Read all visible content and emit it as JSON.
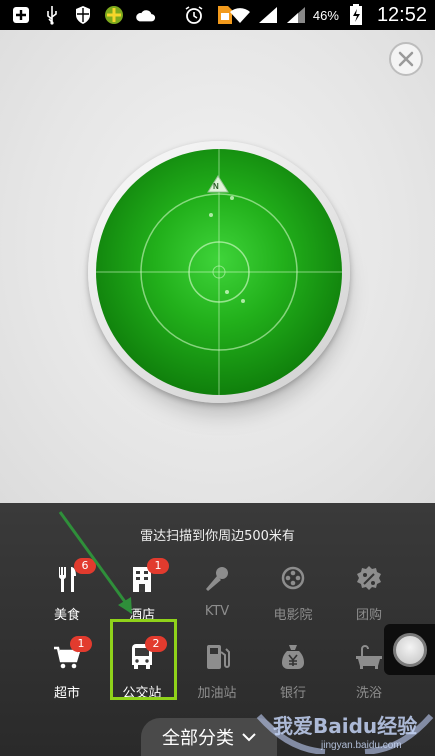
{
  "status_bar": {
    "battery_percent": "46%",
    "time": "12:52",
    "left_icons": [
      "plus-icon",
      "usb-icon",
      "shield-icon",
      "app-icon",
      "cloud-icon",
      "alarm-icon",
      "sim-icon"
    ],
    "right_icons": [
      "wifi-icon",
      "signal-icon",
      "signal-icon",
      "battery-icon"
    ]
  },
  "radar": {
    "compass_label": "N",
    "accent_color": "#22b01b"
  },
  "panel": {
    "title": "雷达扫描到你周边500米有",
    "categories": [
      {
        "label": "美食",
        "badge": "6",
        "active": true,
        "icon": "fork-knife-icon"
      },
      {
        "label": "酒店",
        "badge": "1",
        "active": true,
        "icon": "hotel-building-icon"
      },
      {
        "label": "KTV",
        "badge": "",
        "active": false,
        "icon": "microphone-icon"
      },
      {
        "label": "电影院",
        "badge": "",
        "active": false,
        "icon": "film-reel-icon"
      },
      {
        "label": "团购",
        "badge": "",
        "active": false,
        "icon": "percent-icon"
      },
      {
        "label": "超市",
        "badge": "1",
        "active": true,
        "icon": "shopping-cart-icon"
      },
      {
        "label": "公交站",
        "badge": "2",
        "active": true,
        "icon": "bus-icon"
      },
      {
        "label": "加油站",
        "badge": "",
        "active": false,
        "icon": "gas-pump-icon"
      },
      {
        "label": "银行",
        "badge": "",
        "active": false,
        "icon": "yen-bag-icon"
      },
      {
        "label": "洗浴",
        "badge": "",
        "active": false,
        "icon": "bathtub-icon"
      }
    ],
    "all_categories_label": "全部分类",
    "badge_color": "#e23b2e",
    "highlight_color": "#8fd21a"
  },
  "watermark": {
    "main": "我爱Baidu经验",
    "sub": "jingyan.baidu.com"
  }
}
